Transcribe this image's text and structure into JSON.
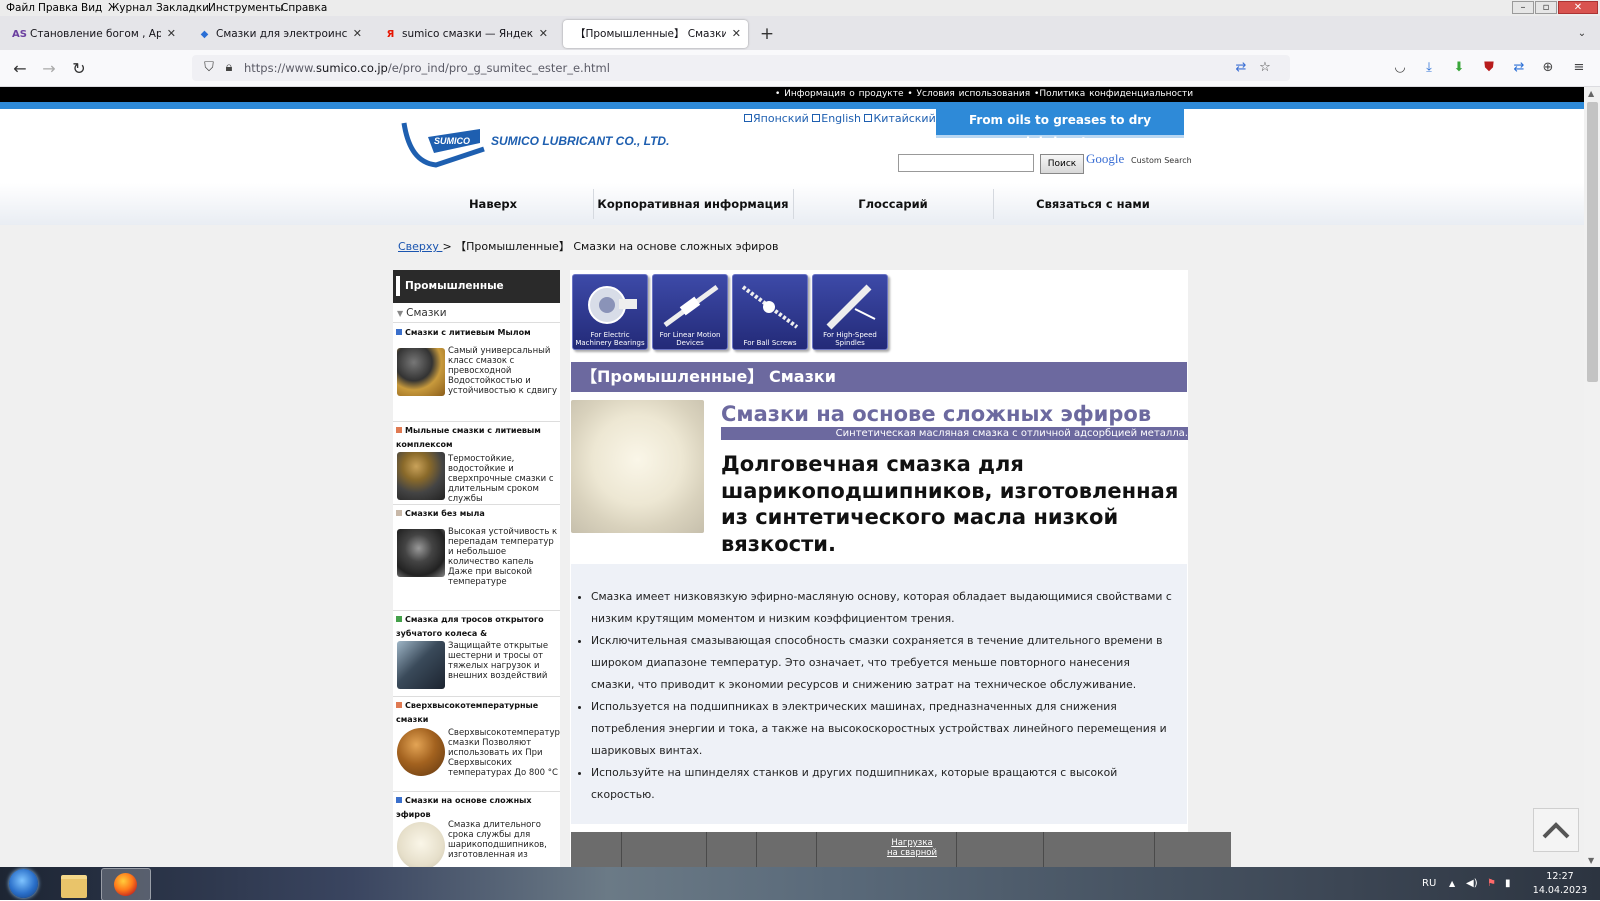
{
  "menubar": {
    "items": [
      "Файл",
      "Правка",
      "Вид",
      "Журнал",
      "Закладки",
      "Инструменты",
      "Справка"
    ],
    "window_controls": {
      "minimize": "–",
      "maximize": "▫",
      "close": "✕"
    }
  },
  "tabs": [
    {
      "title": "Становление богом , Apotheo",
      "favicon": "AS",
      "close": "✕"
    },
    {
      "title": "Смазки для электроинструмен",
      "favicon": "◆",
      "close": "✕"
    },
    {
      "title": "sumico смазки — Яндекс: наш",
      "favicon": "Я",
      "close": "✕"
    },
    {
      "title": "【Промышленные】 Смазки на о",
      "favicon": "",
      "close": "✕"
    }
  ],
  "new_tab": "+",
  "nav": {
    "back": "←",
    "forward": "→",
    "reload": "↻",
    "url_prefix": "https://www.",
    "url_domain": "sumico.co.jp",
    "url_path": "/e/pro_ind/pro_g_sumitec_ester_e.html"
  },
  "page": {
    "top_links": "• Информация о продукте  • Условия использования  •Политика конфиденциальности",
    "logo_text": "SUMICO",
    "company_name": "SUMICO LUBRICANT CO., LTD.",
    "languages": [
      "Японский",
      "English",
      "Китайский"
    ],
    "tagline": "From oils to greases to dry lubricants",
    "search_button": "Поиск",
    "search_brand": "Google",
    "search_label": "Custom Search",
    "global_nav": [
      "Наверх",
      "Корпоративная информация",
      "Глоссарий",
      "Связаться с нами"
    ],
    "breadcrumb": {
      "link": "Сверху ",
      "sep": "> ",
      "current": "【Промышленные】 Смазки на основе сложных эфиров"
    },
    "sidebar": {
      "header": "Промышленные продукты",
      "sub": "Смазки",
      "items": [
        {
          "title": "Смазки с литиевым Мылом",
          "desc": "Самый универсальный класс смазок с превосходной Водостойкостью и устойчивостью к сдвигу",
          "bullet": "#3a6fcb"
        },
        {
          "title": "Мыльные смазки с литиевым комплексом",
          "desc": "Термостойкие, водостойкие и сверхпрочные смазки с длительным сроком службы",
          "bullet": "#e07a52"
        },
        {
          "title": "Смазки без мыла",
          "desc": "Высокая устойчивость к перепадам температур и небольшое количество капель Даже при высокой температуре",
          "bullet": "#c8b8a8"
        },
        {
          "title": "Смазка для тросов открытого зубчатого колеса &",
          "desc": "Защищайте открытые шестерни и тросы от тяжелых нагрузок и внешних воздействий",
          "bullet": "#44a04a"
        },
        {
          "title": "Сверхвысокотемпературные смазки",
          "desc": "Сверхвысокотемпературные смазки Позволяют использовать их При Сверхвысоких температурах До 800 °C",
          "bullet": "#e07a52"
        },
        {
          "title": "Смазки на основе сложных эфиров",
          "desc": "Смазка длительного срока службы для шарикоподшипников, изготовленная из",
          "bullet": "#3a6fcb"
        }
      ]
    },
    "app_icons": [
      "For Electric Machinery Bearings",
      "For Linear Motion Devices",
      "For Ball Screws",
      "For High-Speed Spindles"
    ],
    "category_bar": "【Промышленные】  Смазки",
    "product_title": "Смазки на основе сложных эфиров",
    "product_subtitle": "Синтетическая масляная смазка с отличной адсорбцией металла.",
    "product_headline": "Долговечная смазка для шарикоподшипников, изготовленная из синтетического масла низкой вязкости.",
    "features": [
      "Смазка имеет низковязкую эфирно-масляную основу, которая обладает выдающимися свойствами с низким крутящим моментом и низким коэффициентом трения.",
      "Исключительная смазывающая способность смазки сохраняется в течение длительного времени в широком диапазоне температур. Это означает, что требуется меньше повторного нанесения смазки, что приводит к экономии ресурсов и снижению затрат на техническое обслуживание.",
      "Используется на подшипниках в электрических машинах, предназначенных для снижения потребления энергии и тока, а также на высокоскоростных устройствах линейного перемещения и шариковых винтах.",
      "Используйте на шпинделях станков и других подшипниках, которые вращаются с высокой скоростью."
    ],
    "table_header_visible": "Нагрузка на сварной"
  },
  "taskbar": {
    "lang": "RU",
    "time": "12:27",
    "date": "14.04.2023"
  }
}
